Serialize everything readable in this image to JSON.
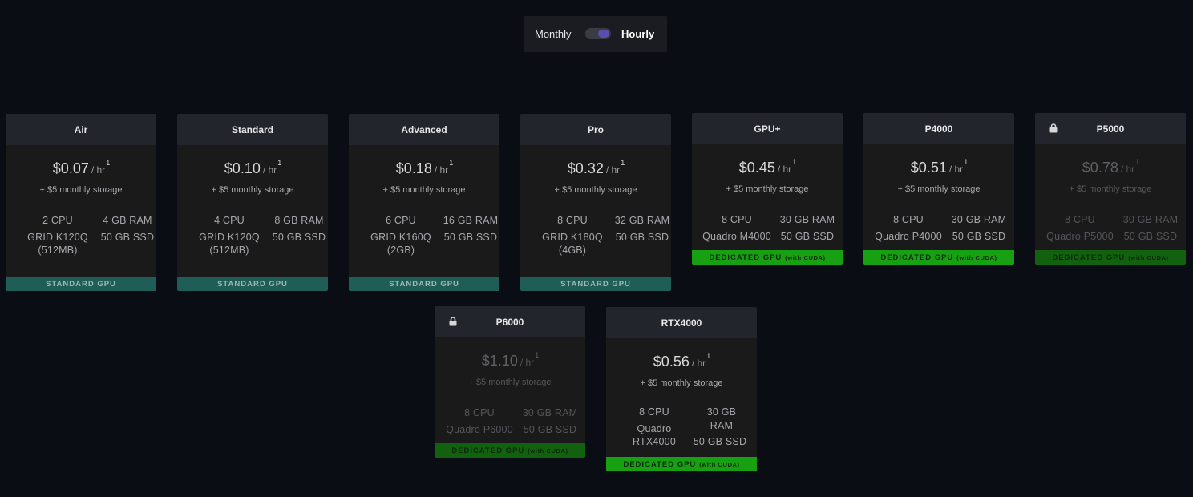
{
  "toggle": {
    "monthly_label": "Monthly",
    "hourly_label": "Hourly"
  },
  "unit": "/ hr",
  "footnote": "1",
  "storage": "+ $5 monthly storage",
  "badges": {
    "standard": "STANDARD GPU",
    "dedicated": "DEDICATED GPU",
    "dedicated_small": "(with CUDA)"
  },
  "plans": [
    {
      "name": "Air",
      "price": "$0.07",
      "cpu": "2 CPU",
      "gpu": "GRID K120Q (512MB)",
      "ram": "4 GB RAM",
      "ssd": "50 GB SSD",
      "type": "standard",
      "locked": false
    },
    {
      "name": "Standard",
      "price": "$0.10",
      "cpu": "4 CPU",
      "gpu": "GRID K120Q (512MB)",
      "ram": "8 GB RAM",
      "ssd": "50 GB SSD",
      "type": "standard",
      "locked": false
    },
    {
      "name": "Advanced",
      "price": "$0.18",
      "cpu": "6 CPU",
      "gpu": "GRID K160Q (2GB)",
      "ram": "16 GB RAM",
      "ssd": "50 GB SSD",
      "type": "standard",
      "locked": false
    },
    {
      "name": "Pro",
      "price": "$0.32",
      "cpu": "8 CPU",
      "gpu": "GRID K180Q (4GB)",
      "ram": "32 GB RAM",
      "ssd": "50 GB SSD",
      "type": "standard",
      "locked": false
    },
    {
      "name": "GPU+",
      "price": "$0.45",
      "cpu": "8 CPU",
      "gpu": "Quadro M4000",
      "ram": "30 GB RAM",
      "ssd": "50 GB SSD",
      "type": "dedicated",
      "locked": false
    },
    {
      "name": "P4000",
      "price": "$0.51",
      "cpu": "8 CPU",
      "gpu": "Quadro P4000",
      "ram": "30 GB RAM",
      "ssd": "50 GB SSD",
      "type": "dedicated",
      "locked": false
    },
    {
      "name": "P5000",
      "price": "$0.78",
      "cpu": "8 CPU",
      "gpu": "Quadro P5000",
      "ram": "30 GB RAM",
      "ssd": "50 GB SSD",
      "type": "dedicated",
      "locked": true
    },
    {
      "name": "P6000",
      "price": "$1.10",
      "cpu": "8 CPU",
      "gpu": "Quadro P6000",
      "ram": "30 GB RAM",
      "ssd": "50 GB SSD",
      "type": "dedicated",
      "locked": true
    },
    {
      "name": "RTX4000",
      "price": "$0.56",
      "cpu": "8 CPU",
      "gpu": "Quadro RTX4000",
      "ram": "30 GB RAM",
      "ssd": "50 GB SSD",
      "type": "dedicated",
      "locked": false
    }
  ]
}
